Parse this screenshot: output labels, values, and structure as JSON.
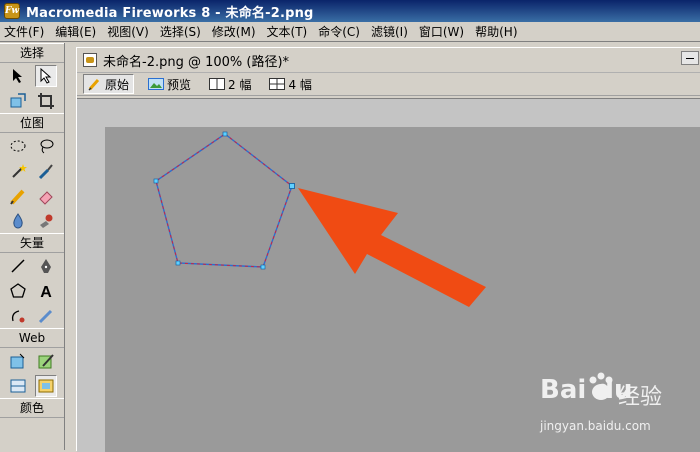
{
  "window": {
    "title": "Macromedia Fireworks 8 - 未命名-2.png",
    "app_icon_text": "Fw"
  },
  "menu": [
    {
      "label": "文件(F)"
    },
    {
      "label": "编辑(E)"
    },
    {
      "label": "视图(V)"
    },
    {
      "label": "选择(S)"
    },
    {
      "label": "修改(M)"
    },
    {
      "label": "文本(T)"
    },
    {
      "label": "命令(C)"
    },
    {
      "label": "滤镜(I)"
    },
    {
      "label": "窗口(W)"
    },
    {
      "label": "帮助(H)"
    }
  ],
  "toolbox": {
    "sections": [
      {
        "label": "选择"
      },
      {
        "label": "位图"
      },
      {
        "label": "矢量"
      },
      {
        "label": "Web"
      },
      {
        "label": "颜色"
      }
    ]
  },
  "document": {
    "title": "未命名-2.png @ 100% (路径)*",
    "view_tabs": [
      {
        "label": "原始",
        "icon": "pencil-icon",
        "active": true
      },
      {
        "label": "预览",
        "icon": "image-icon",
        "active": false
      },
      {
        "label": "2 幅",
        "icon": "two-up-icon",
        "active": false
      },
      {
        "label": "4 幅",
        "icon": "four-up-icon",
        "active": false
      }
    ]
  },
  "canvas": {
    "shape": "pentagon",
    "stroke_colors": [
      "#cc2244",
      "#2a6fd0"
    ],
    "arrow_color": "#f04b13",
    "background_color": "#9a9a9a"
  },
  "watermark": {
    "logo": "Bai du",
    "label": "经验",
    "url": "jingyan.baidu.com"
  }
}
